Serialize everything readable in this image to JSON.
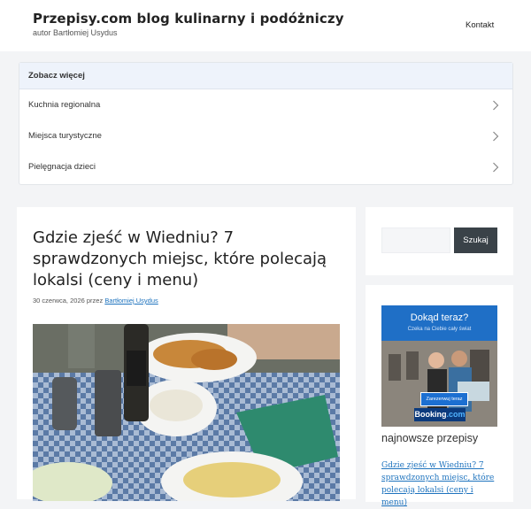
{
  "header": {
    "site_title": "Przepisy.com blog kulinarny i podóżniczy",
    "site_description": "autor Bartłomiej Usydus",
    "nav": [
      {
        "label": "Kontakt"
      }
    ]
  },
  "see_more": {
    "heading": "Zobacz więcej",
    "items": [
      {
        "label": "Kuchnia regionalna"
      },
      {
        "label": "Miejsca turystyczne"
      },
      {
        "label": "Pielęgnacja dzieci"
      }
    ]
  },
  "article": {
    "title": "Gdzie zjeść w Wiedniu? 7 sprawdzonych miejsc, które polecają lokalsi (ceny i menu)",
    "date": "30 czerwca, 2026",
    "by_label": "przez",
    "author": "Bartłomiej Usydus",
    "image_icon": "food-photo-icon"
  },
  "sidebar": {
    "search": {
      "placeholder": "",
      "value": "",
      "button_label": "Szukaj"
    },
    "ad": {
      "headline": "Dokąd teraz?",
      "subline": "Czeka na Ciebie cały świat",
      "button_label": "Zarezerwuj teraz",
      "brand_main": "Booking",
      "brand_suffix": ".com"
    },
    "latest_heading": "najnowsze przepisy",
    "latest_link": "Gdzie zjeść w Wiedniu? 7 sprawdzonych miejsc, które polecają lokalsi (ceny i menu)"
  },
  "colors": {
    "link": "#1e73be",
    "search_button": "#3a4248",
    "ad_blue": "#1f6fc6",
    "booking_navy": "#0b3a7d"
  }
}
